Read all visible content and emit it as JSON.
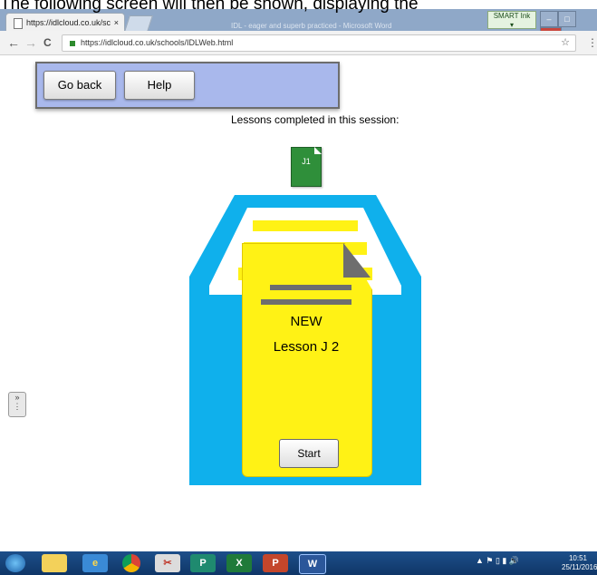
{
  "caption": "The following screen will then be shown, displaying the",
  "browser": {
    "tab_title": "https://idlcloud.co.uk/sc",
    "tab_close": "×",
    "window_title": "IDL - eager and superb practiced - Microsoft Word",
    "smart_ink_label": "SMART Ink",
    "back_icon": "←",
    "forward_icon": "→",
    "reload_icon": "C",
    "url": "https://idlcloud.co.uk/schools/IDLWeb.html",
    "star_icon": "☆",
    "menu_icon": "⋮"
  },
  "toolbar": {
    "go_back_label": "Go back",
    "help_label": "Help"
  },
  "main": {
    "lessons_completed_label": "Lessons completed in this session:",
    "completed_lessons": [
      "J1"
    ],
    "card": {
      "status": "NEW",
      "lesson_title": "Lesson J 2",
      "start_label": "Start"
    },
    "side_handle_icon": "»"
  },
  "taskbar": {
    "apps": [
      "start-orb",
      "file-explorer",
      "internet-explorer",
      "chrome",
      "snipping-tool",
      "publisher",
      "excel",
      "powerpoint",
      "word"
    ],
    "clock_time": "10:51",
    "clock_date": "25/11/2016"
  },
  "colors": {
    "toolbar_bg": "#a9b8ec",
    "cabinet_blue": "#0fb0ec",
    "card_yellow": "#fff215",
    "lesson_green": "#2f8f3a"
  }
}
